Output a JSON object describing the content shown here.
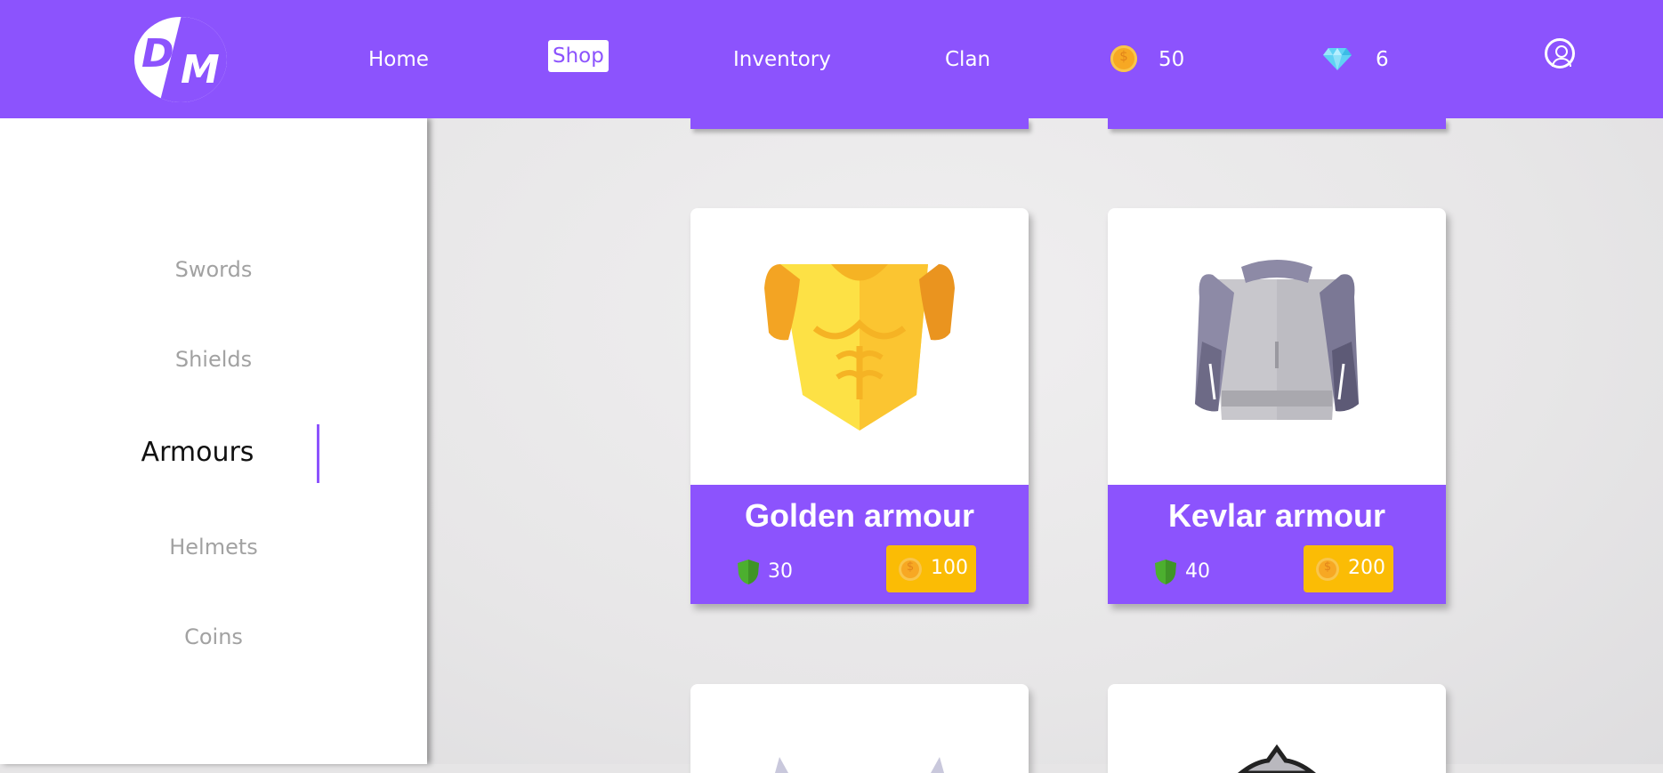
{
  "brand": {
    "logo_letters": "DM"
  },
  "nav": {
    "home": "Home",
    "shop": "Shop",
    "inventory": "Inventory",
    "clan": "Clan"
  },
  "wallet": {
    "coins": "50",
    "gems": "6"
  },
  "icons": {
    "coin": "coin-icon",
    "gem": "diamond-icon",
    "user": "user-account-icon",
    "defense": "shield-icon"
  },
  "colors": {
    "brand": "#8c53fd",
    "price_button": "#fbbc05",
    "defense_shield": "#4caf2f",
    "inactive_category": "#a2a2a2"
  },
  "sidebar": {
    "categories": [
      {
        "label": "Swords"
      },
      {
        "label": "Shields"
      },
      {
        "label": "Armours"
      },
      {
        "label": "Helmets"
      },
      {
        "label": "Coins"
      }
    ],
    "active": "Armours"
  },
  "items": [
    {
      "name": "Golden armour",
      "defense": "30",
      "price": "100"
    },
    {
      "name": "Kevlar armour",
      "defense": "40",
      "price": "200"
    }
  ]
}
